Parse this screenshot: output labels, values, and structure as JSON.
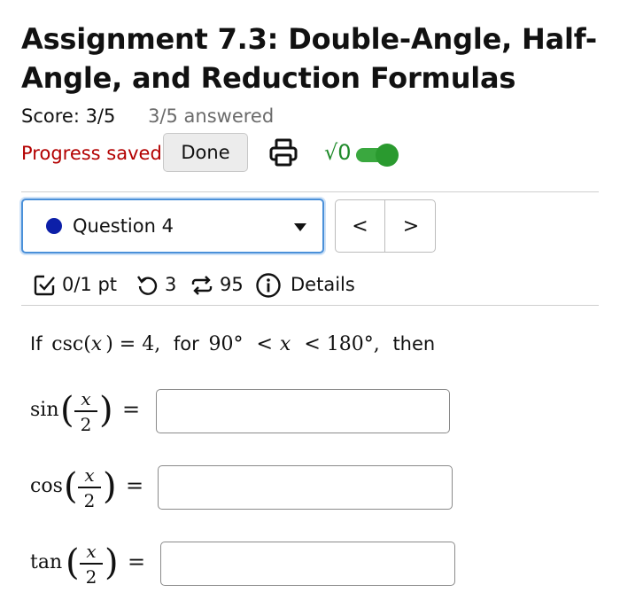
{
  "assignment": {
    "title": "Assignment 7.3: Double-Angle, Half-Angle, and Reduction Formulas",
    "score": "Score: 3/5",
    "answered": "3/5 answered"
  },
  "toolbar": {
    "progress_status": "Progress saved",
    "done_label": "Done",
    "print_icon": "printer-icon",
    "math_mode_label": "√0",
    "math_toggle_on": true
  },
  "question_nav": {
    "selected": "Question 4",
    "prev_label": "<",
    "next_label": ">"
  },
  "question_meta": {
    "points": "0/1 pt",
    "retries": "3",
    "attempts": "95",
    "details_label": "Details"
  },
  "question": {
    "prompt_if": "If",
    "prompt_csc": "csc(",
    "prompt_var": "x",
    "prompt_eq": ") = 4,",
    "prompt_for": "for",
    "prompt_range_start": "90°",
    "prompt_lt": "<",
    "prompt_range_end": "< 180°,",
    "prompt_then": "then",
    "parts": [
      {
        "fn": "sin",
        "numerator": "x",
        "denominator": "2",
        "equals": "=",
        "value": ""
      },
      {
        "fn": "cos",
        "numerator": "x",
        "denominator": "2",
        "equals": "=",
        "value": ""
      },
      {
        "fn": "tan",
        "numerator": "x",
        "denominator": "2",
        "equals": "=",
        "value": ""
      }
    ]
  },
  "colors": {
    "progress_saved": "#b30000",
    "toggle_on": "#2a9a2f",
    "question_dot": "#0c1fa8",
    "focus_border": "#4a90d9"
  }
}
